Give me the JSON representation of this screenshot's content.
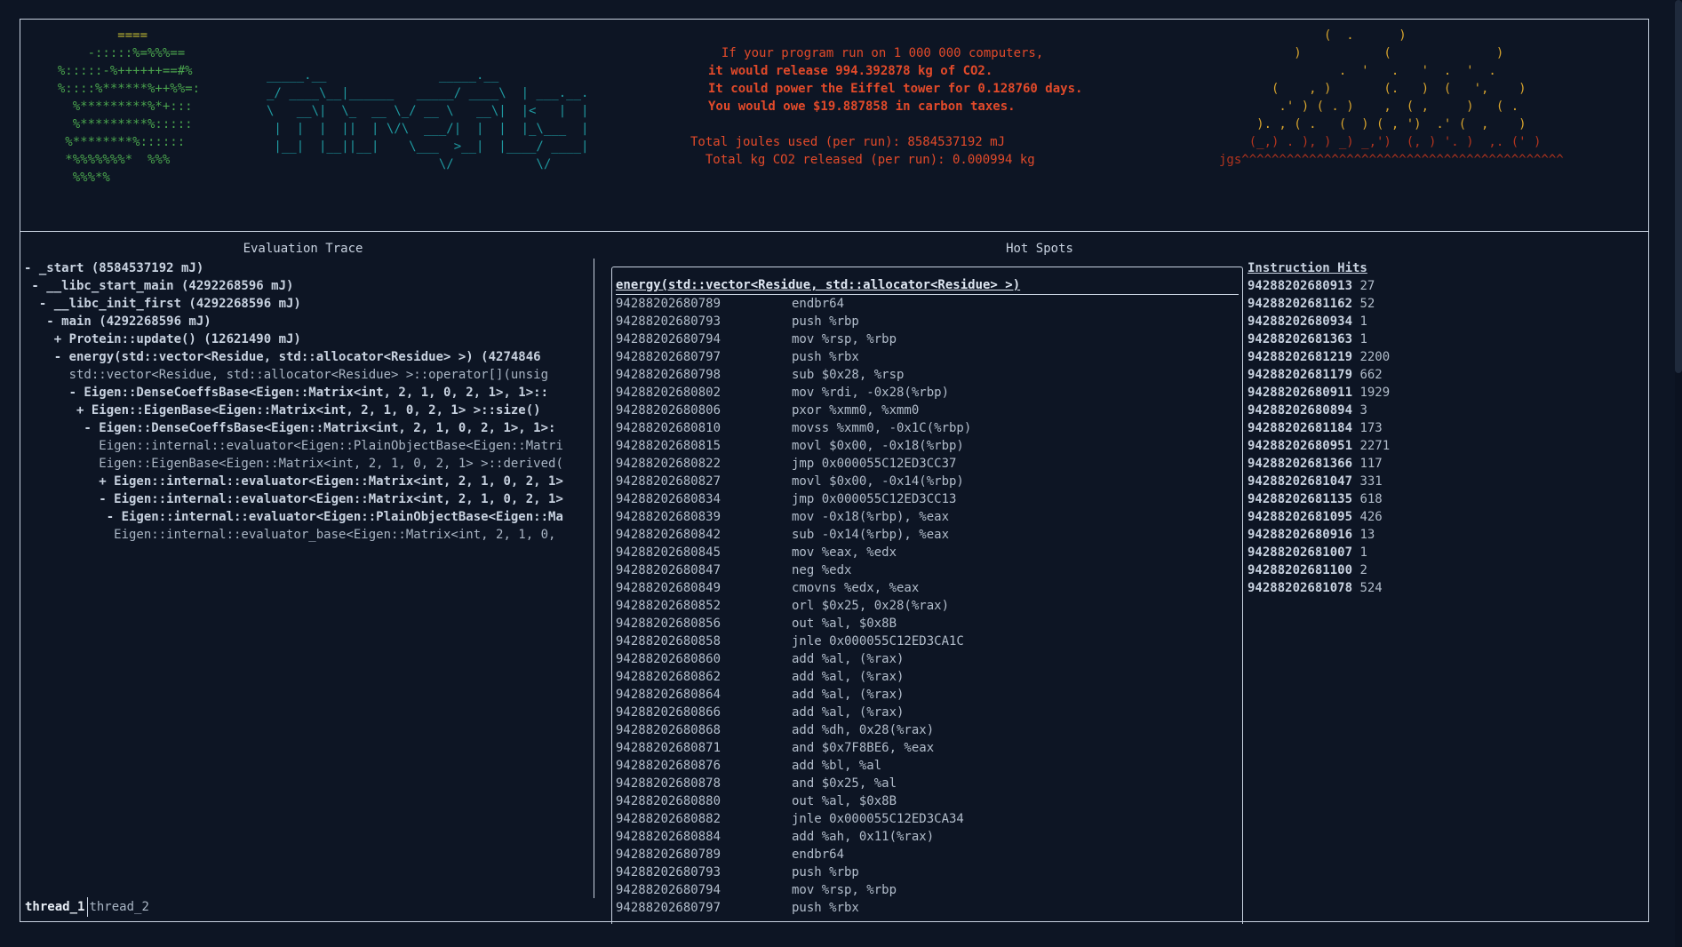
{
  "header": {
    "leaf_art": [
      "          ====",
      "      -:::::%=%%%==",
      "  %:::::-%++++++==#%",
      "  %::::%******%++%%=:",
      "    %*********%*+:::",
      "    %*********%:::::",
      "   %********%::::::",
      "   *%%%%%%%*  %%%",
      "    %%%*%"
    ],
    "logo_art": [
      "_____.__               _____.__",
      "_/ ____\\__|______   _____/ ____\\  | ___.__.",
      "\\   __\\|  \\_  __ \\_/ __ \\   __\\|  |<   |  |",
      " |  |  |  ||  | \\/\\  ___/|  |  |  |_\\___  |",
      " |__|  |__||__|    \\___  >__|  |____/ ____|",
      "                       \\/           \\/"
    ],
    "message_lines": [
      {
        "text": "  If your program run on 1 000 000 computers,",
        "bold": false
      },
      {
        "text": "it would release 994.392878 kg of CO2.",
        "bold": true
      },
      {
        "text": "It could power the Eiffel tower for 0.128760 days.",
        "bold": true
      },
      {
        "text": "You would owe $19.887858 in carbon taxes.",
        "bold": true
      },
      {
        "text": "",
        "bold": false
      },
      {
        "text": "Total joules used (per run): 8584537192 mJ",
        "bold": false
      },
      {
        "text": "  Total kg CO2 released (per run): 0.000994 kg",
        "bold": false
      }
    ],
    "fire_art": [
      "              (  .      )",
      "          )           (              )",
      "                .  '   .   '  .  '  .",
      "       (    , )       (.   )  (   ',    )",
      "        .' ) ( . )    ,  ( ,     )   ( .",
      "     ). , ( .   (  ) ( , ')  .' (  ,    )",
      "    (_,) . ), ) _) _,')  (, ) '. )  ,. (' )",
      "jgs^^^^^^^^^^^^^^^^^^^^^^^^^^^^^^^^^^^^^^^^^^^"
    ]
  },
  "trace": {
    "title": "Evaluation Trace",
    "rows": [
      {
        "text": "- _start (8584537192 mJ)",
        "bold": true
      },
      {
        "text": " - __libc_start_main (4292268596 mJ)",
        "bold": true
      },
      {
        "text": "  - __libc_init_first (4292268596 mJ)",
        "bold": true
      },
      {
        "text": "   - main (4292268596 mJ)",
        "bold": true
      },
      {
        "text": "    + Protein::update() (12621490 mJ)",
        "bold": true
      },
      {
        "text": "    - energy(std::vector<Residue, std::allocator<Residue> >) (4274846",
        "bold": true
      },
      {
        "text": "      std::vector<Residue, std::allocator<Residue> >::operator[](unsig",
        "bold": false
      },
      {
        "text": "      - Eigen::DenseCoeffsBase<Eigen::Matrix<int, 2, 1, 0, 2, 1>, 1>::",
        "bold": true
      },
      {
        "text": "       + Eigen::EigenBase<Eigen::Matrix<int, 2, 1, 0, 2, 1> >::size()",
        "bold": true
      },
      {
        "text": "        - Eigen::DenseCoeffsBase<Eigen::Matrix<int, 2, 1, 0, 2, 1>, 1>:",
        "bold": true
      },
      {
        "text": "          Eigen::internal::evaluator<Eigen::PlainObjectBase<Eigen::Matri",
        "bold": false
      },
      {
        "text": "          Eigen::EigenBase<Eigen::Matrix<int, 2, 1, 0, 2, 1> >::derived(",
        "bold": false
      },
      {
        "text": "          + Eigen::internal::evaluator<Eigen::Matrix<int, 2, 1, 0, 2, 1>",
        "bold": true
      },
      {
        "text": "          - Eigen::internal::evaluator<Eigen::Matrix<int, 2, 1, 0, 2, 1>",
        "bold": true
      },
      {
        "text": "           - Eigen::internal::evaluator<Eigen::PlainObjectBase<Eigen::Ma",
        "bold": true
      },
      {
        "text": "            Eigen::internal::evaluator_base<Eigen::Matrix<int, 2, 1, 0,",
        "bold": false
      }
    ]
  },
  "tabs": [
    {
      "label": "thread_1",
      "active": true
    },
    {
      "label": "thread_2",
      "active": false
    }
  ],
  "hotspots": {
    "title": "Hot Spots",
    "function": "energy(std::vector<Residue, std::allocator<Residue> >)",
    "rows": [
      [
        "94288202680789",
        "endbr64"
      ],
      [
        "94288202680793",
        "push %rbp"
      ],
      [
        "94288202680794",
        "mov %rsp, %rbp"
      ],
      [
        "94288202680797",
        "push %rbx"
      ],
      [
        "94288202680798",
        "sub $0x28, %rsp"
      ],
      [
        "94288202680802",
        "mov %rdi, -0x28(%rbp)"
      ],
      [
        "94288202680806",
        "pxor %xmm0, %xmm0"
      ],
      [
        "94288202680810",
        "movss %xmm0, -0x1C(%rbp)"
      ],
      [
        "94288202680815",
        "movl $0x00, -0x18(%rbp)"
      ],
      [
        "94288202680822",
        "jmp 0x000055C12ED3CC37"
      ],
      [
        "94288202680827",
        "movl $0x00, -0x14(%rbp)"
      ],
      [
        "94288202680834",
        "jmp 0x000055C12ED3CC13"
      ],
      [
        "94288202680839",
        "mov -0x18(%rbp), %eax"
      ],
      [
        "94288202680842",
        "sub -0x14(%rbp), %eax"
      ],
      [
        "94288202680845",
        "mov %eax, %edx"
      ],
      [
        "94288202680847",
        "neg %edx"
      ],
      [
        "94288202680849",
        "cmovns %edx, %eax"
      ],
      [
        "94288202680852",
        "orl $0x25, 0x28(%rax)"
      ],
      [
        "94288202680856",
        "out %al, $0x8B"
      ],
      [
        "94288202680858",
        "jnle 0x000055C12ED3CA1C"
      ],
      [
        "94288202680860",
        "add %al, (%rax)"
      ],
      [
        "94288202680862",
        "add %al, (%rax)"
      ],
      [
        "94288202680864",
        "add %al, (%rax)"
      ],
      [
        "94288202680866",
        "add %al, (%rax)"
      ],
      [
        "94288202680868",
        "add %dh, 0x28(%rax)"
      ],
      [
        "94288202680871",
        "and $0x7F8BE6, %eax"
      ],
      [
        "94288202680876",
        "add %bl, %al"
      ],
      [
        "94288202680878",
        "and $0x25, %al"
      ],
      [
        "94288202680880",
        "out %al, $0x8B"
      ],
      [
        "94288202680882",
        "jnle 0x000055C12ED3CA34"
      ],
      [
        "94288202680884",
        "add %ah, 0x11(%rax)"
      ],
      [
        "94288202680789",
        "endbr64"
      ],
      [
        "94288202680793",
        "push %rbp"
      ],
      [
        "94288202680794",
        "mov %rsp, %rbp"
      ],
      [
        "94288202680797",
        "push %rbx"
      ]
    ]
  },
  "instruction_hits": {
    "title": "Instruction Hits",
    "rows": [
      [
        "94288202680913",
        "27"
      ],
      [
        "94288202681162",
        "52"
      ],
      [
        "94288202680934",
        "1"
      ],
      [
        "94288202681363",
        "1"
      ],
      [
        "94288202681219",
        "2200"
      ],
      [
        "94288202681179",
        "662"
      ],
      [
        "94288202680911",
        "1929"
      ],
      [
        "94288202680894",
        "3"
      ],
      [
        "94288202681184",
        "173"
      ],
      [
        "94288202680951",
        "2271"
      ],
      [
        "94288202681366",
        "117"
      ],
      [
        "94288202681047",
        "331"
      ],
      [
        "94288202681135",
        "618"
      ],
      [
        "94288202681095",
        "426"
      ],
      [
        "94288202680916",
        "13"
      ],
      [
        "94288202681007",
        "1"
      ],
      [
        "94288202681100",
        "2"
      ],
      [
        "94288202681078",
        "524"
      ]
    ]
  }
}
